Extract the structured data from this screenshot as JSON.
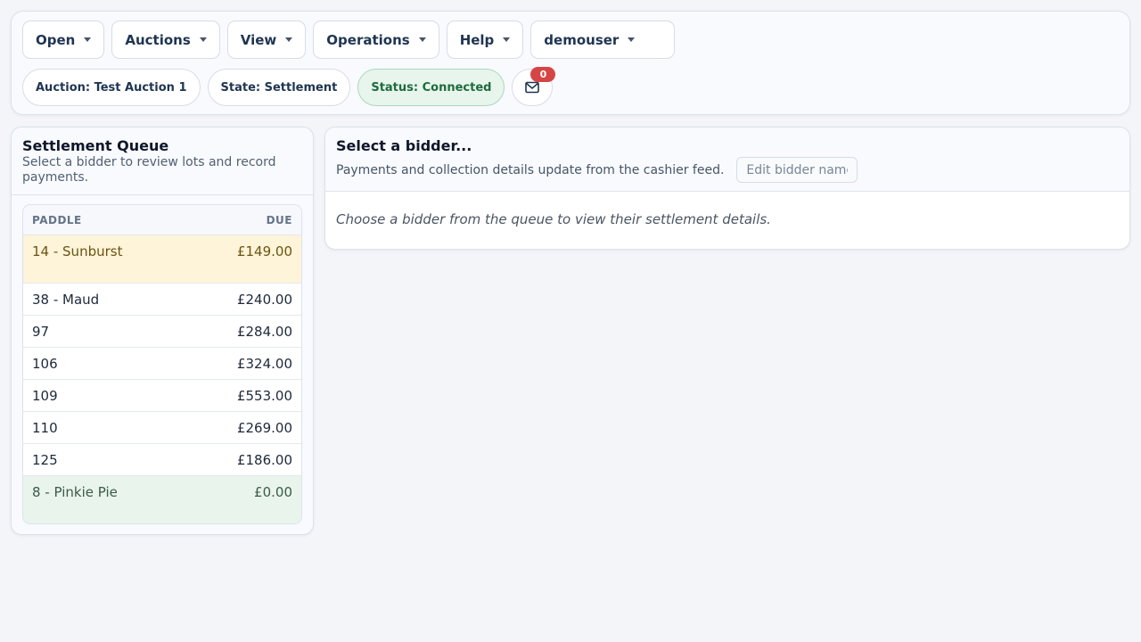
{
  "menus": [
    {
      "label": "Open"
    },
    {
      "label": "Auctions"
    },
    {
      "label": "View"
    },
    {
      "label": "Operations"
    },
    {
      "label": "Help"
    }
  ],
  "user_menu": {
    "label": "demouser"
  },
  "chips": {
    "auction": "Auction: Test Auction 1",
    "state": "State: Settlement",
    "status": "Status: Connected"
  },
  "messages": {
    "count": "0",
    "icon": "mail-icon"
  },
  "queue": {
    "title": "Settlement Queue",
    "subtitle": "Select a bidder to review lots and record payments.",
    "columns": {
      "paddle": "PADDLE",
      "due": "DUE"
    },
    "rows": [
      {
        "paddle": "14 - Sunburst",
        "due": "£149.00",
        "state": "selected"
      },
      {
        "paddle": "38 - Maud",
        "due": "£240.00",
        "state": "normal"
      },
      {
        "paddle": "97",
        "due": "£284.00",
        "state": "normal"
      },
      {
        "paddle": "106",
        "due": "£324.00",
        "state": "normal"
      },
      {
        "paddle": "109",
        "due": "£553.00",
        "state": "normal"
      },
      {
        "paddle": "110",
        "due": "£269.00",
        "state": "normal"
      },
      {
        "paddle": "125",
        "due": "£186.00",
        "state": "normal"
      },
      {
        "paddle": "8 - Pinkie Pie",
        "due": "£0.00",
        "state": "paid"
      }
    ]
  },
  "detail": {
    "title": "Select a bidder...",
    "subtitle": "Payments and collection details update from the cashier feed.",
    "edit_placeholder": "Edit bidder name",
    "empty_message": "Choose a bidder from the queue to view their settlement details."
  },
  "colors": {
    "background": "#f3f5f9",
    "selected_row": "#fdf4d9",
    "paid_row": "#e9f5ec",
    "status_chip": "#e7f5ec",
    "badge": "#d64545"
  }
}
